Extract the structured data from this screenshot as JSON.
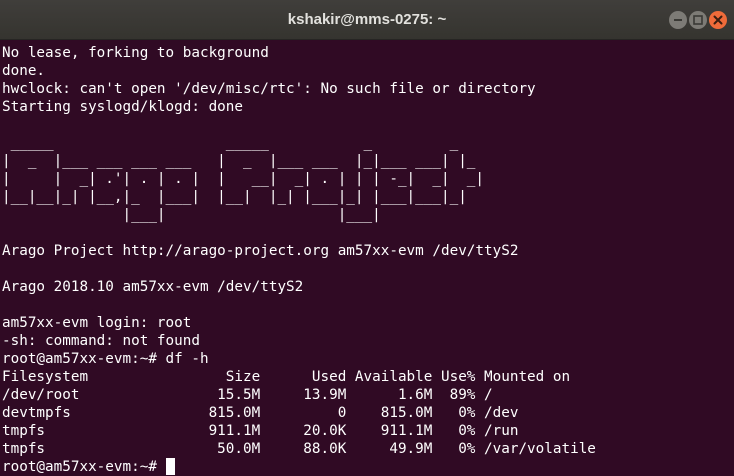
{
  "window": {
    "title": "kshakir@mms-0275: ~",
    "controls": {
      "minimize_icon": "minimize-icon",
      "maximize_icon": "maximize-icon",
      "close_icon": "close-icon"
    }
  },
  "colors": {
    "terminal_background": "#300a24",
    "terminal_text": "#ffffff",
    "titlebar": "#3c3b37",
    "close_button": "#ef6b3a"
  },
  "terminal": {
    "lines": [
      "No lease, forking to background",
      "done.",
      "hwclock: can't open '/dev/misc/rtc': No such file or directory",
      "Starting syslogd/klogd: done",
      "",
      " _____                    _____           _         _",
      "|  _  |___ ___ ___ ___   |  _  |___ ___  |_|___ ___| |_",
      "|     |  _| .'| . | . |  |   __|  _| . | | | -_|  _|  _|",
      "|__|__|_| |__,|_  |___|  |__|  |_| |___|_| |___|___|_|",
      "              |___|                    |___|",
      "",
      "Arago Project http://arago-project.org am57xx-evm /dev/ttyS2",
      "",
      "Arago 2018.10 am57xx-evm /dev/ttyS2",
      "",
      "am57xx-evm login: root",
      "-sh: command: not found",
      "root@am57xx-evm:~# df -h",
      "Filesystem                Size      Used Available Use% Mounted on",
      "/dev/root                15.5M     13.9M      1.6M  89% /",
      "devtmpfs                815.0M         0    815.0M   0% /dev",
      "tmpfs                   911.1M     20.0K    911.1M   0% /run",
      "tmpfs                    50.0M     88.0K     49.9M   0% /var/volatile"
    ],
    "prompt": "root@am57xx-evm:~# "
  }
}
